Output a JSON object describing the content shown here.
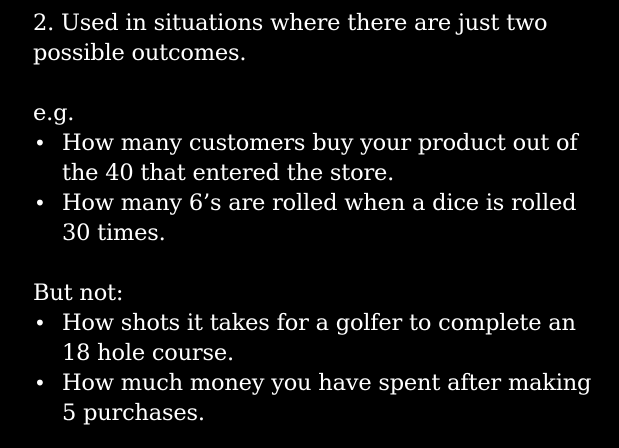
{
  "slide": {
    "intro": "2.  Used in situations where there are just two possible outcomes.",
    "examples_heading": "e.g.",
    "examples": [
      "How many customers buy your product out of the 40 that entered the store.",
      "How many 6’s are rolled when a dice is rolled 30 times."
    ],
    "non_examples_heading": "But not:",
    "non_examples": [
      "How shots it takes for a golfer to complete an 18 hole course.",
      "How much money you have spent after making 5 purchases."
    ],
    "bullet_glyph": "•"
  }
}
